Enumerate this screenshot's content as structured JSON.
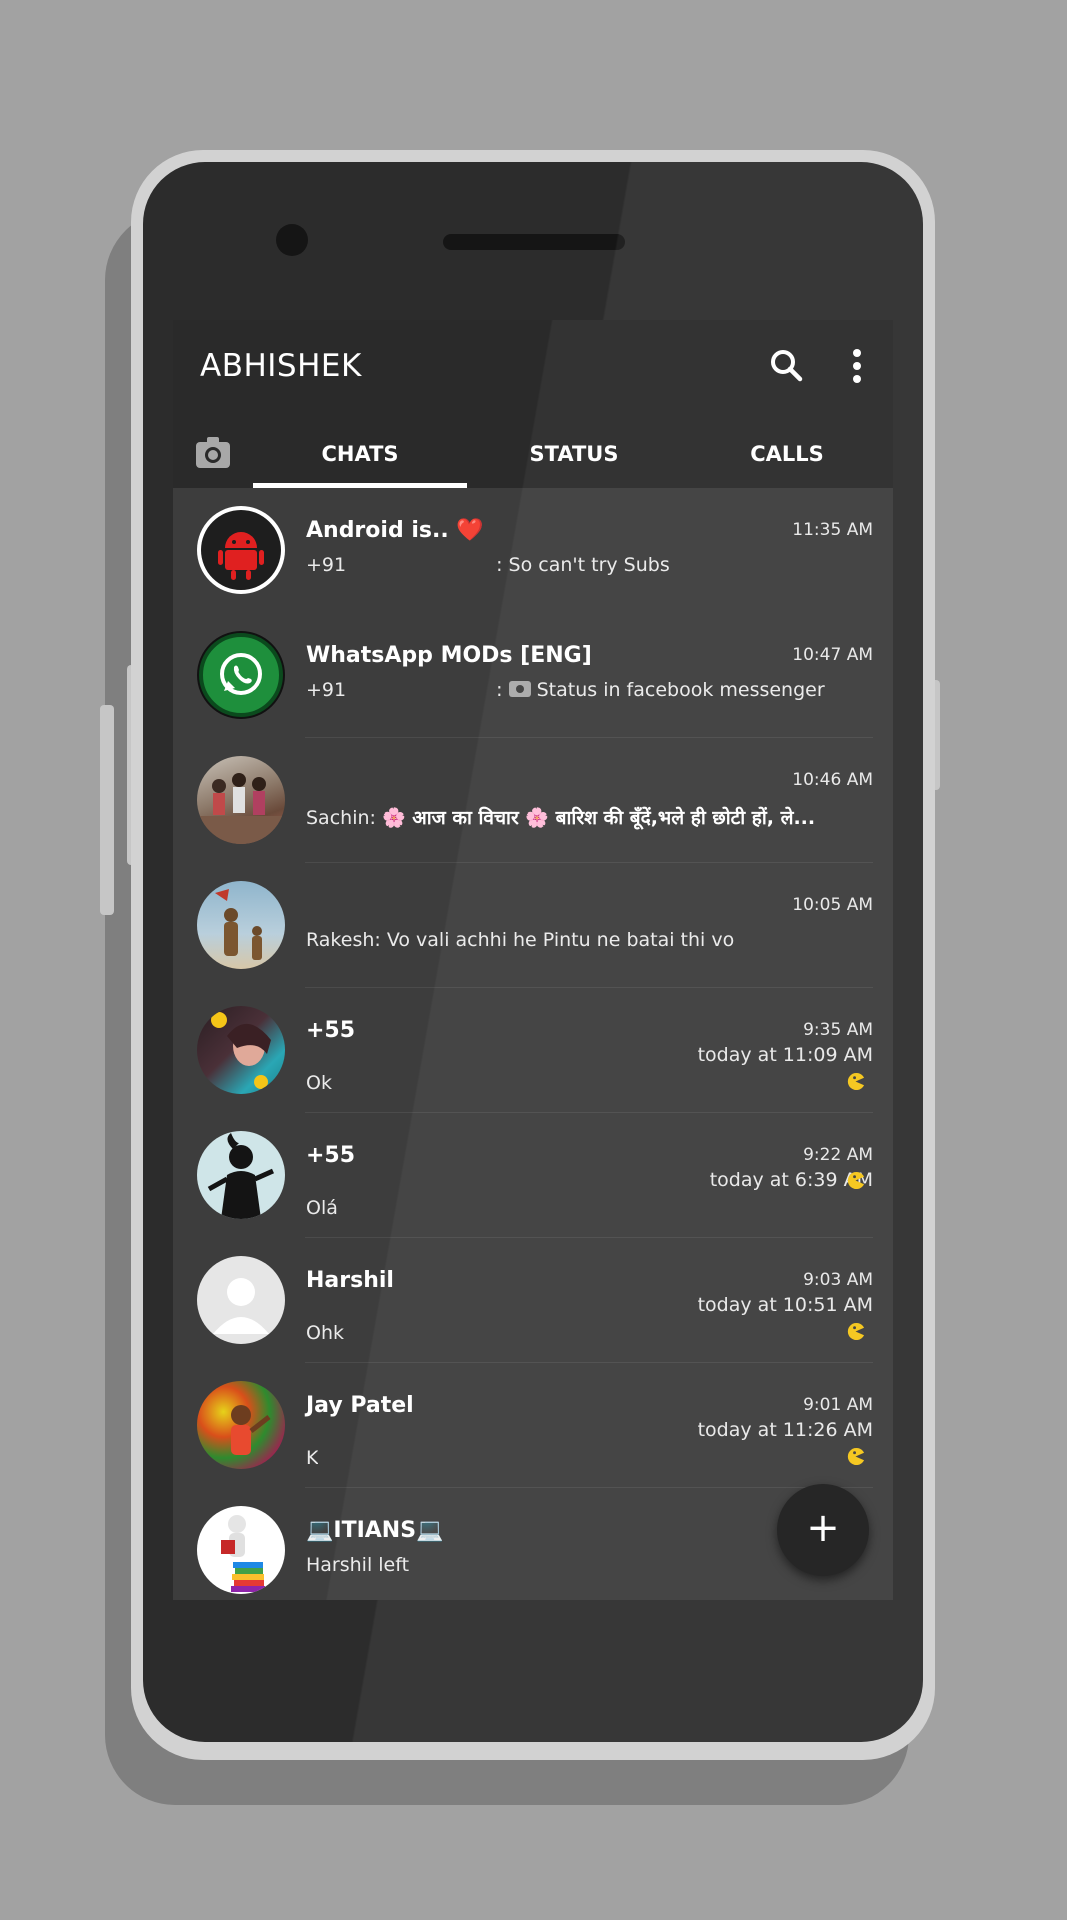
{
  "theme": {
    "background": "#a2a2a2",
    "appbar": "#2a2a2a",
    "list_bg": "#3d3d3d",
    "text": "#ffffff",
    "accent_emoji": "#f5c518"
  },
  "appbar": {
    "title": "ABHISHEK",
    "search_icon": "search-icon",
    "menu_icon": "more-vert-icon"
  },
  "tabs": {
    "camera_icon": "camera-icon",
    "items": [
      {
        "label": "CHATS",
        "active": true
      },
      {
        "label": "STATUS",
        "active": false
      },
      {
        "label": "CALLS",
        "active": false
      }
    ]
  },
  "chats": [
    {
      "name": "Android is..",
      "name_emoji": "❤️",
      "time": "11:35 AM",
      "sender": "+91",
      "message": ": So can't try Subs",
      "avatar": "android-robot-icon"
    },
    {
      "name": "WhatsApp MODs [ENG]",
      "time": "10:47 AM",
      "sender": "+91",
      "message": "Status in facebook messenger",
      "message_prefix": ":",
      "message_icon": "camera-icon",
      "avatar": "whatsapp-logo-icon"
    },
    {
      "name": "",
      "time": "10:46 AM",
      "sender": "Sachin:",
      "message": "🌸 आज का विचार 🌸  बारिश की बूँदें,भले ही छोटी हों, ले...",
      "avatar": "group-photo"
    },
    {
      "name": "",
      "time": "10:05 AM",
      "sender": "Rakesh:",
      "message": "Vo vali achhi he Pintu ne batai thi vo",
      "avatar": "statue-photo"
    },
    {
      "name": "+55",
      "time": "9:35 AM",
      "time2": "today at 11:09 AM",
      "message": "Ok",
      "avatar": "profile-photo"
    },
    {
      "name": "+55",
      "time": "9:22 AM",
      "time2": "today at 6:39 AM",
      "message": "Olá",
      "avatar": "silhouette-photo"
    },
    {
      "name": "Harshil",
      "time": "9:03 AM",
      "time2": "today at 10:51 AM",
      "message": "Ohk",
      "avatar": "default-avatar-icon"
    },
    {
      "name": "Jay Patel",
      "time": "9:01 AM",
      "time2": "today at 11:26 AM",
      "message": "K",
      "avatar": "colorful-photo"
    },
    {
      "name": "💻ITIANS💻",
      "time": "",
      "message": "Harshil left",
      "avatar": "books-figure-photo"
    }
  ],
  "fab": {
    "label": "+",
    "icon": "add-icon"
  }
}
